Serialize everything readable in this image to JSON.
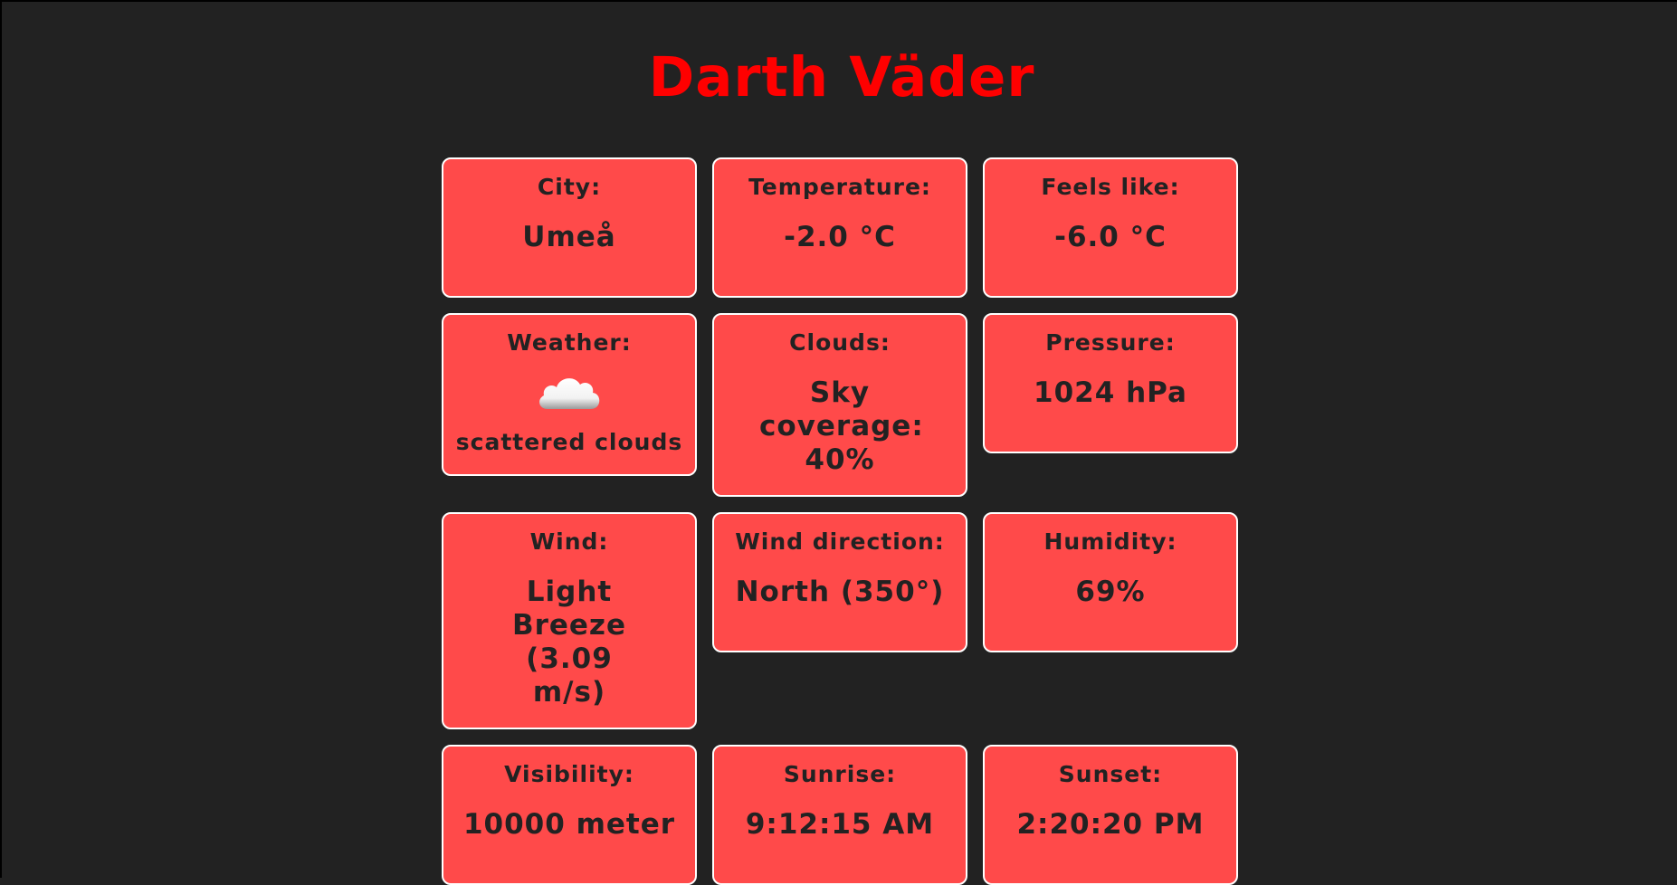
{
  "page": {
    "title": "Darth Väder"
  },
  "cards": {
    "city": {
      "label": "City:",
      "value": "Umeå"
    },
    "temperature": {
      "label": "Temperature:",
      "value": "-2.0 °C"
    },
    "feels_like": {
      "label": "Feels like:",
      "value": "-6.0 °C"
    },
    "weather": {
      "label": "Weather:",
      "icon": "cloud-icon",
      "description": "scattered clouds"
    },
    "clouds": {
      "label": "Clouds:",
      "value": "Sky coverage: 40%"
    },
    "pressure": {
      "label": "Pressure:",
      "value": "1024 hPa"
    },
    "wind": {
      "label": "Wind:",
      "value": "Light Breeze (3.09 m/s)"
    },
    "wind_direction": {
      "label": "Wind direction:",
      "value": "North (350°)"
    },
    "humidity": {
      "label": "Humidity:",
      "value": "69%"
    },
    "visibility": {
      "label": "Visibility:",
      "value": "10000 meter"
    },
    "sunrise": {
      "label": "Sunrise:",
      "value": "9:12:15 AM"
    },
    "sunset": {
      "label": "Sunset:",
      "value": "2:20:20 PM"
    }
  },
  "colors": {
    "background": "#222222",
    "title": "#ff0000",
    "card_background": "#ff4a4a",
    "card_border": "#ffffff",
    "card_text": "#222222"
  }
}
